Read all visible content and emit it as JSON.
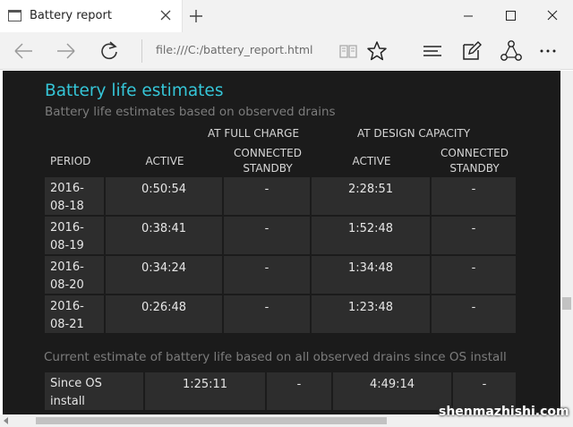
{
  "tab": {
    "title": "Battery report"
  },
  "nav": {
    "address": "file:///C:/battery_report.html"
  },
  "report": {
    "title": "Battery life estimates",
    "subtitle": "Battery life estimates based on observed drains",
    "group_full": "AT FULL CHARGE",
    "group_design": "AT DESIGN CAPACITY",
    "col_period": "PERIOD",
    "col_active_full": "ACTIVE",
    "col_standby_full_1": "CONNECTED",
    "col_standby_full_2": "STANDBY",
    "col_active_design": "ACTIVE",
    "col_standby_design_1": "CONNECTED",
    "col_standby_design_2": "STANDBY",
    "rows": [
      {
        "period_1": "2016-",
        "period_2": "08-18",
        "active_full": "0:50:54",
        "standby_full": "-",
        "active_design": "2:28:51",
        "standby_design": "-"
      },
      {
        "period_1": "2016-",
        "period_2": "08-19",
        "active_full": "0:38:41",
        "standby_full": "-",
        "active_design": "1:52:48",
        "standby_design": "-"
      },
      {
        "period_1": "2016-",
        "period_2": "08-20",
        "active_full": "0:34:24",
        "standby_full": "-",
        "active_design": "1:34:48",
        "standby_design": "-"
      },
      {
        "period_1": "2016-",
        "period_2": "08-21",
        "active_full": "0:26:48",
        "standby_full": "-",
        "active_design": "1:23:48",
        "standby_design": "-"
      }
    ],
    "current_estimate_caption": "Current estimate of battery life based on all observed drains since OS install",
    "since": {
      "label_1": "Since OS",
      "label_2": "install",
      "active_full": "1:25:11",
      "standby_full": "-",
      "active_design": "4:49:14",
      "standby_design": "-"
    }
  },
  "watermark": "shenmazhishi.com",
  "icons": [
    "page-icon",
    "close-icon",
    "plus-icon",
    "minimize-icon",
    "maximize-icon",
    "window-close-icon",
    "back-arrow-icon",
    "forward-arrow-icon",
    "refresh-icon",
    "reading-view-icon",
    "star-icon",
    "hub-icon",
    "web-note-icon",
    "share-icon",
    "more-icon"
  ],
  "colors": {
    "heading": "#35c5d7",
    "page_bg": "#1b1b1b",
    "cell_bg": "#2d2d2d",
    "chrome_bg": "#f2f2f2"
  }
}
